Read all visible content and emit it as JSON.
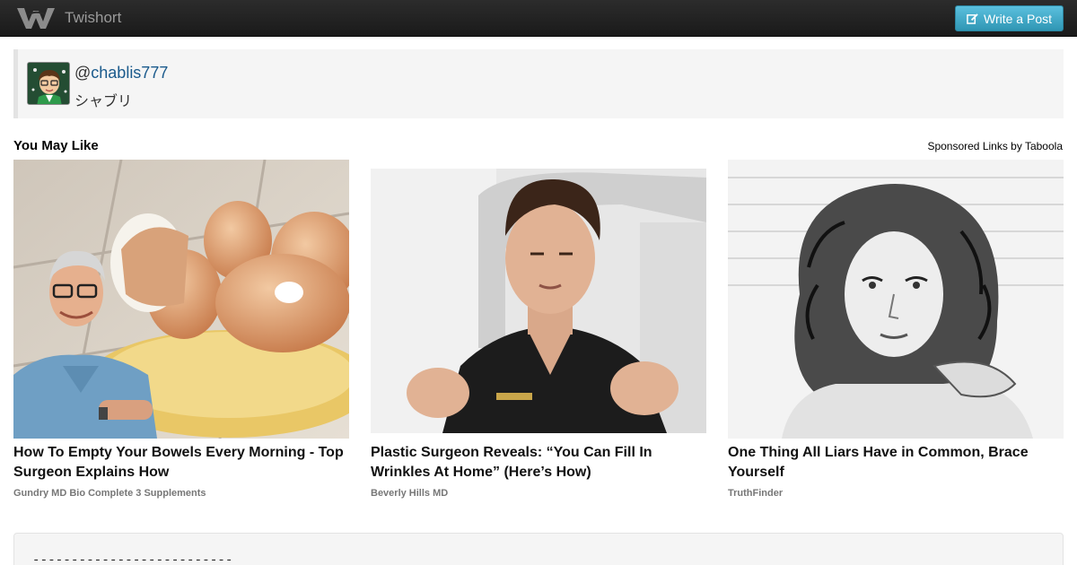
{
  "navbar": {
    "brand_name": "Twishort",
    "write_button_label": "Write a Post"
  },
  "profile": {
    "handle_prefix": "@",
    "handle": "chablis777",
    "display_name": "シャブリ"
  },
  "recommendations": {
    "title": "You May Like",
    "sponsored_label": "Sponsored Links by Taboola",
    "cards": [
      {
        "title_line1": "How To Empty Your Bowels Every Morning - Top",
        "title_line2": "Surgeon Explains How",
        "source": "Gundry MD Bio Complete 3 Supplements"
      },
      {
        "title_line1": "Plastic Surgeon Reveals: “You Can Fill In",
        "title_line2": "Wrinkles At Home” (Here’s How)",
        "source": "Beverly Hills MD"
      },
      {
        "title_line1": "One Thing All Liars Have in Common, Brace",
        "title_line2": "Yourself",
        "source": "TruthFinder"
      }
    ]
  },
  "post": {
    "separator": "--------------------------"
  },
  "colors": {
    "navbar_bg": "#1f1f1f",
    "button_accent": "#49afcd",
    "link": "#1a5a8c",
    "panel_bg": "#f5f5f5"
  }
}
